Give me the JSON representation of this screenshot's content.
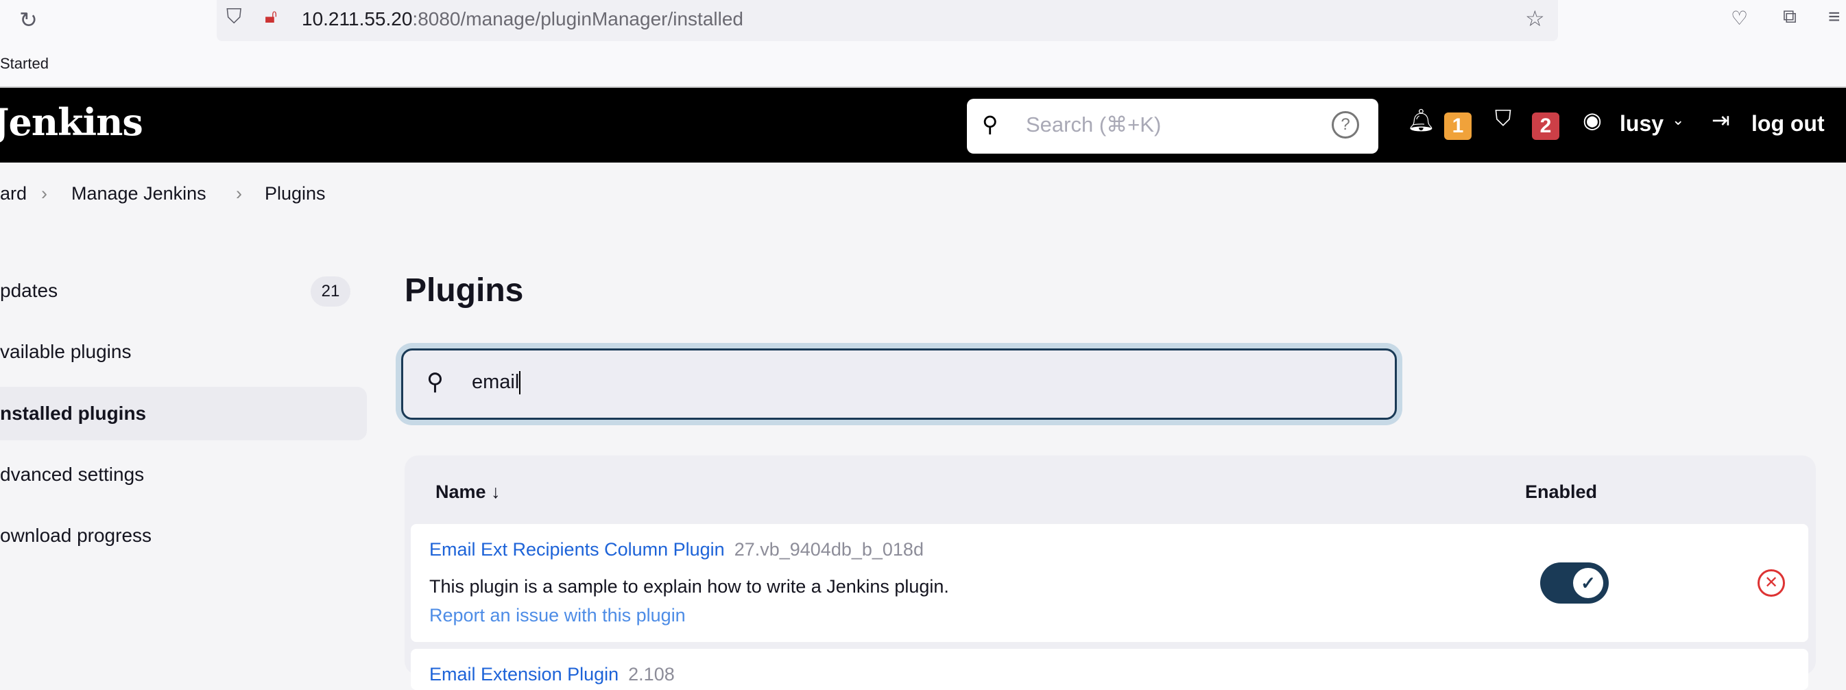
{
  "browser": {
    "url_host": "10.211.55.20",
    "url_path": ":8080/manage/pluginManager/installed",
    "bookmark": "Started"
  },
  "header": {
    "logo": "Jenkins",
    "search_placeholder": "Search (⌘+K)",
    "notifications_count": "1",
    "security_count": "2",
    "user": "lusy",
    "logout": "log out",
    "notification_color": "#f0a23a",
    "security_color": "#cc3f47"
  },
  "breadcrumb": [
    "ard",
    "Manage Jenkins",
    "Plugins"
  ],
  "sidebar": {
    "items": [
      {
        "label": "pdates",
        "count": "21"
      },
      {
        "label": "vailable plugins"
      },
      {
        "label": "nstalled plugins",
        "active": true
      },
      {
        "label": "dvanced settings"
      },
      {
        "label": "ownload progress"
      }
    ]
  },
  "main": {
    "title": "Plugins",
    "filter_value": "email",
    "table": {
      "col_name": "Name",
      "sort_icon": "arrow-down",
      "col_enabled": "Enabled",
      "rows": [
        {
          "name": "Email Ext Recipients Column Plugin",
          "version": "27.vb_9404db_b_018d",
          "description": "This plugin is a sample to explain how to write a Jenkins plugin.",
          "report": "Report an issue with this plugin",
          "enabled": true
        },
        {
          "name": "Email Extension Plugin",
          "version": "2.108"
        }
      ]
    }
  }
}
